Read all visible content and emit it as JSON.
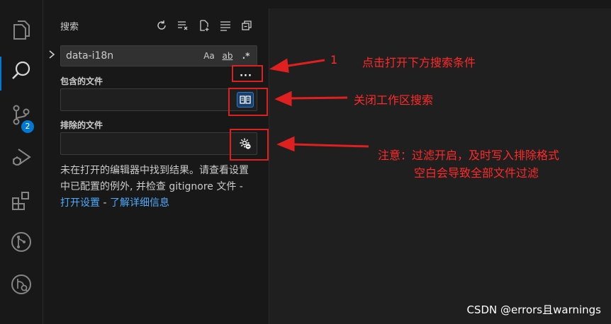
{
  "activity_bar": {
    "items": [
      {
        "name": "explorer-icon"
      },
      {
        "name": "search-icon"
      },
      {
        "name": "source-control-icon",
        "badge": "2"
      },
      {
        "name": "run-debug-icon"
      },
      {
        "name": "extensions-icon"
      },
      {
        "name": "git-graph-icon"
      },
      {
        "name": "git-lens-icon"
      }
    ]
  },
  "sidebar": {
    "title": "搜索",
    "search": {
      "value": "data-i18n",
      "match_case": "Aa",
      "whole_word": "ab",
      "regex": ".*"
    },
    "more_toggle": "···",
    "include_label": "包含的文件",
    "exclude_label": "排除的文件",
    "message": {
      "text": "未在打开的编辑器中找到结果。请查看设置中已配置的例外, 并检查 gitignore 文件 - ",
      "link_settings": "打开设置",
      "sep": " - ",
      "link_learn": "了解详细信息"
    }
  },
  "annotations": {
    "note1_num": "1",
    "note1_text": "点击打开下方搜索条件",
    "note2_text": "关闭工作区搜索",
    "note3_line1": "注意：过滤开启，及时写入排除格式",
    "note3_line2": "空白会导致全部文件过滤"
  },
  "watermark": "CSDN @errors且warnings",
  "colors": {
    "accent": "#0078d4",
    "link": "#4daafc",
    "annotation": "#e02020"
  }
}
